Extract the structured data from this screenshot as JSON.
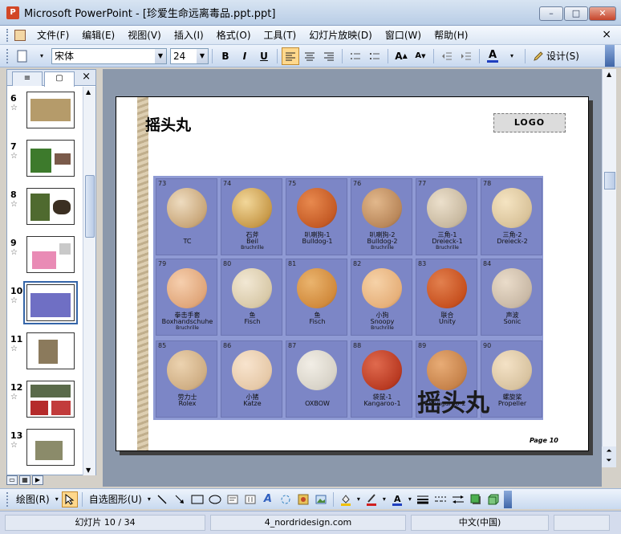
{
  "window": {
    "title": "Microsoft PowerPoint - [珍爱生命远离毒品.ppt.ppt]",
    "app_icon": "P",
    "min": "–",
    "max": "□",
    "close": "✕"
  },
  "menu": {
    "items": [
      "文件(F)",
      "编辑(E)",
      "视图(V)",
      "插入(I)",
      "格式(O)",
      "工具(T)",
      "幻灯片放映(D)",
      "窗口(W)",
      "帮助(H)"
    ],
    "close": "×"
  },
  "toolbar": {
    "font_name": "宋体",
    "font_size": "24",
    "bold": "B",
    "italic": "I",
    "underline": "U",
    "font_color": "A",
    "design_label": "设计(S)"
  },
  "left_pane": {
    "tab_outline": "≡",
    "tab_slides": "▢",
    "close": "×",
    "star": "☆",
    "thumbnails": [
      {
        "num": "6",
        "color": "#b59b6a"
      },
      {
        "num": "7",
        "color": "#3d7a2c"
      },
      {
        "num": "8",
        "color": "#4f6a2f"
      },
      {
        "num": "9",
        "color": "#e98bb5"
      },
      {
        "num": "10",
        "color": "#6f6fc4",
        "selected": true
      },
      {
        "num": "11",
        "color": "#8b7a5c"
      },
      {
        "num": "12",
        "color": "#b52b2b"
      },
      {
        "num": "13",
        "color": "#8b8b6a"
      }
    ]
  },
  "slide": {
    "title": "摇头丸",
    "logo": "LOGO",
    "overlay_text": "摇头丸",
    "page_label": "Page  10",
    "pills": [
      {
        "num": "73",
        "name": "",
        "sub": "TC",
        "sub2": "",
        "color": "#c9a77a"
      },
      {
        "num": "74",
        "name": "石斧",
        "sub": "Beil",
        "sub2": "Bruchrille",
        "color": "#c89a4a"
      },
      {
        "num": "75",
        "name": "叭喇狗-1",
        "sub": "Bulldog-1",
        "sub2": "",
        "color": "#c45a25"
      },
      {
        "num": "76",
        "name": "叭喇狗-2",
        "sub": "Bulldog-2",
        "sub2": "Bruchrille",
        "color": "#b9875a"
      },
      {
        "num": "77",
        "name": "三角-1",
        "sub": "Dreieck-1",
        "sub2": "Bruchrille",
        "color": "#c8b9a0"
      },
      {
        "num": "78",
        "name": "三角-2",
        "sub": "Dreieck-2",
        "sub2": "",
        "color": "#d9c39a"
      },
      {
        "num": "79",
        "name": "拳击手套",
        "sub": "Boxhandschuhe",
        "sub2": "Bruchrille",
        "color": "#e0a67a"
      },
      {
        "num": "80",
        "name": "鱼",
        "sub": "Fisch",
        "sub2": "",
        "color": "#d8c9a8"
      },
      {
        "num": "81",
        "name": "鱼",
        "sub": "Fisch",
        "sub2": "",
        "color": "#d18a3c"
      },
      {
        "num": "82",
        "name": "小狗",
        "sub": "Snoopy",
        "sub2": "Bruchrille",
        "color": "#e6b07a"
      },
      {
        "num": "83",
        "name": "联合",
        "sub": "Unity",
        "sub2": "",
        "color": "#c7501f"
      },
      {
        "num": "84",
        "name": "声波",
        "sub": "Sonic",
        "sub2": "",
        "color": "#c9b9a6"
      },
      {
        "num": "85",
        "name": "劳力士",
        "sub": "Rolex",
        "sub2": "",
        "color": "#cfae84"
      },
      {
        "num": "86",
        "name": "小猪",
        "sub": "Katze",
        "sub2": "",
        "color": "#e6c9a8"
      },
      {
        "num": "87",
        "name": "",
        "sub": "OXBOW",
        "sub2": "",
        "color": "#d8d3c8"
      },
      {
        "num": "88",
        "name": "袋鼠-1",
        "sub": "Kangaroo-1",
        "sub2": "",
        "color": "#b93a22"
      },
      {
        "num": "89",
        "name": "",
        "sub": "Kangaroo-2",
        "sub2": "",
        "color": "#c6824a"
      },
      {
        "num": "90",
        "name": "螺旋桨",
        "sub": "Propeller",
        "sub2": "",
        "color": "#d8c3a0"
      }
    ]
  },
  "draw_toolbar": {
    "draw_label": "绘图(R)",
    "autoshapes_label": "自选图形(U)"
  },
  "status": {
    "slide_info": "幻灯片 10 / 34",
    "template": "4_nordridesign.com",
    "language": "中文(中国)"
  }
}
